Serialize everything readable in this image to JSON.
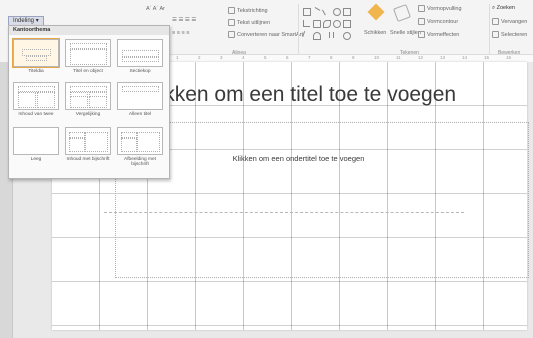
{
  "ribbon": {
    "layout_tab": "Indeling",
    "col1": [
      "A´ A´ Ar",
      "☰ ☰ ☰ ☰",
      "≡ ≡ ≡ ≡"
    ],
    "text_group": [
      "Tekstrichting",
      "Tekst uitlijnen",
      "Converteren naar SmartArt"
    ],
    "text_group_label": "Alinea",
    "arrange": "Schikken",
    "quick_styles": "Snelle stijlen",
    "shape_fill": "Vormopvulling",
    "shape_outline": "Vormcontour",
    "shape_effects": "Vormeffecten",
    "drawing_label": "Tekenen",
    "find": "Zoeken",
    "replace": "Vervangen",
    "select": "Selecteren",
    "editing_label": "Bewerken"
  },
  "ruler_labels": [
    "1",
    "2",
    "3",
    "4",
    "5",
    "6",
    "7",
    "8",
    "9",
    "10",
    "11",
    "12",
    "13",
    "14",
    "15",
    "16"
  ],
  "slide": {
    "title": "Klikken om een titel toe te voegen",
    "subtitle": "Klikken om een ondertitel toe te voegen"
  },
  "layout_dropdown": {
    "header": "Kantoorthema",
    "items": [
      {
        "label": "Titeldia",
        "selected": true
      },
      {
        "label": "Titel en object"
      },
      {
        "label": "Sectiekop"
      },
      {
        "label": "Inhoud van twee"
      },
      {
        "label": "Vergelijking"
      },
      {
        "label": "Alleen titel"
      },
      {
        "label": "Leeg"
      },
      {
        "label": "Inhoud met bijschrift"
      },
      {
        "label": "Afbeelding met bijschrift"
      }
    ]
  }
}
